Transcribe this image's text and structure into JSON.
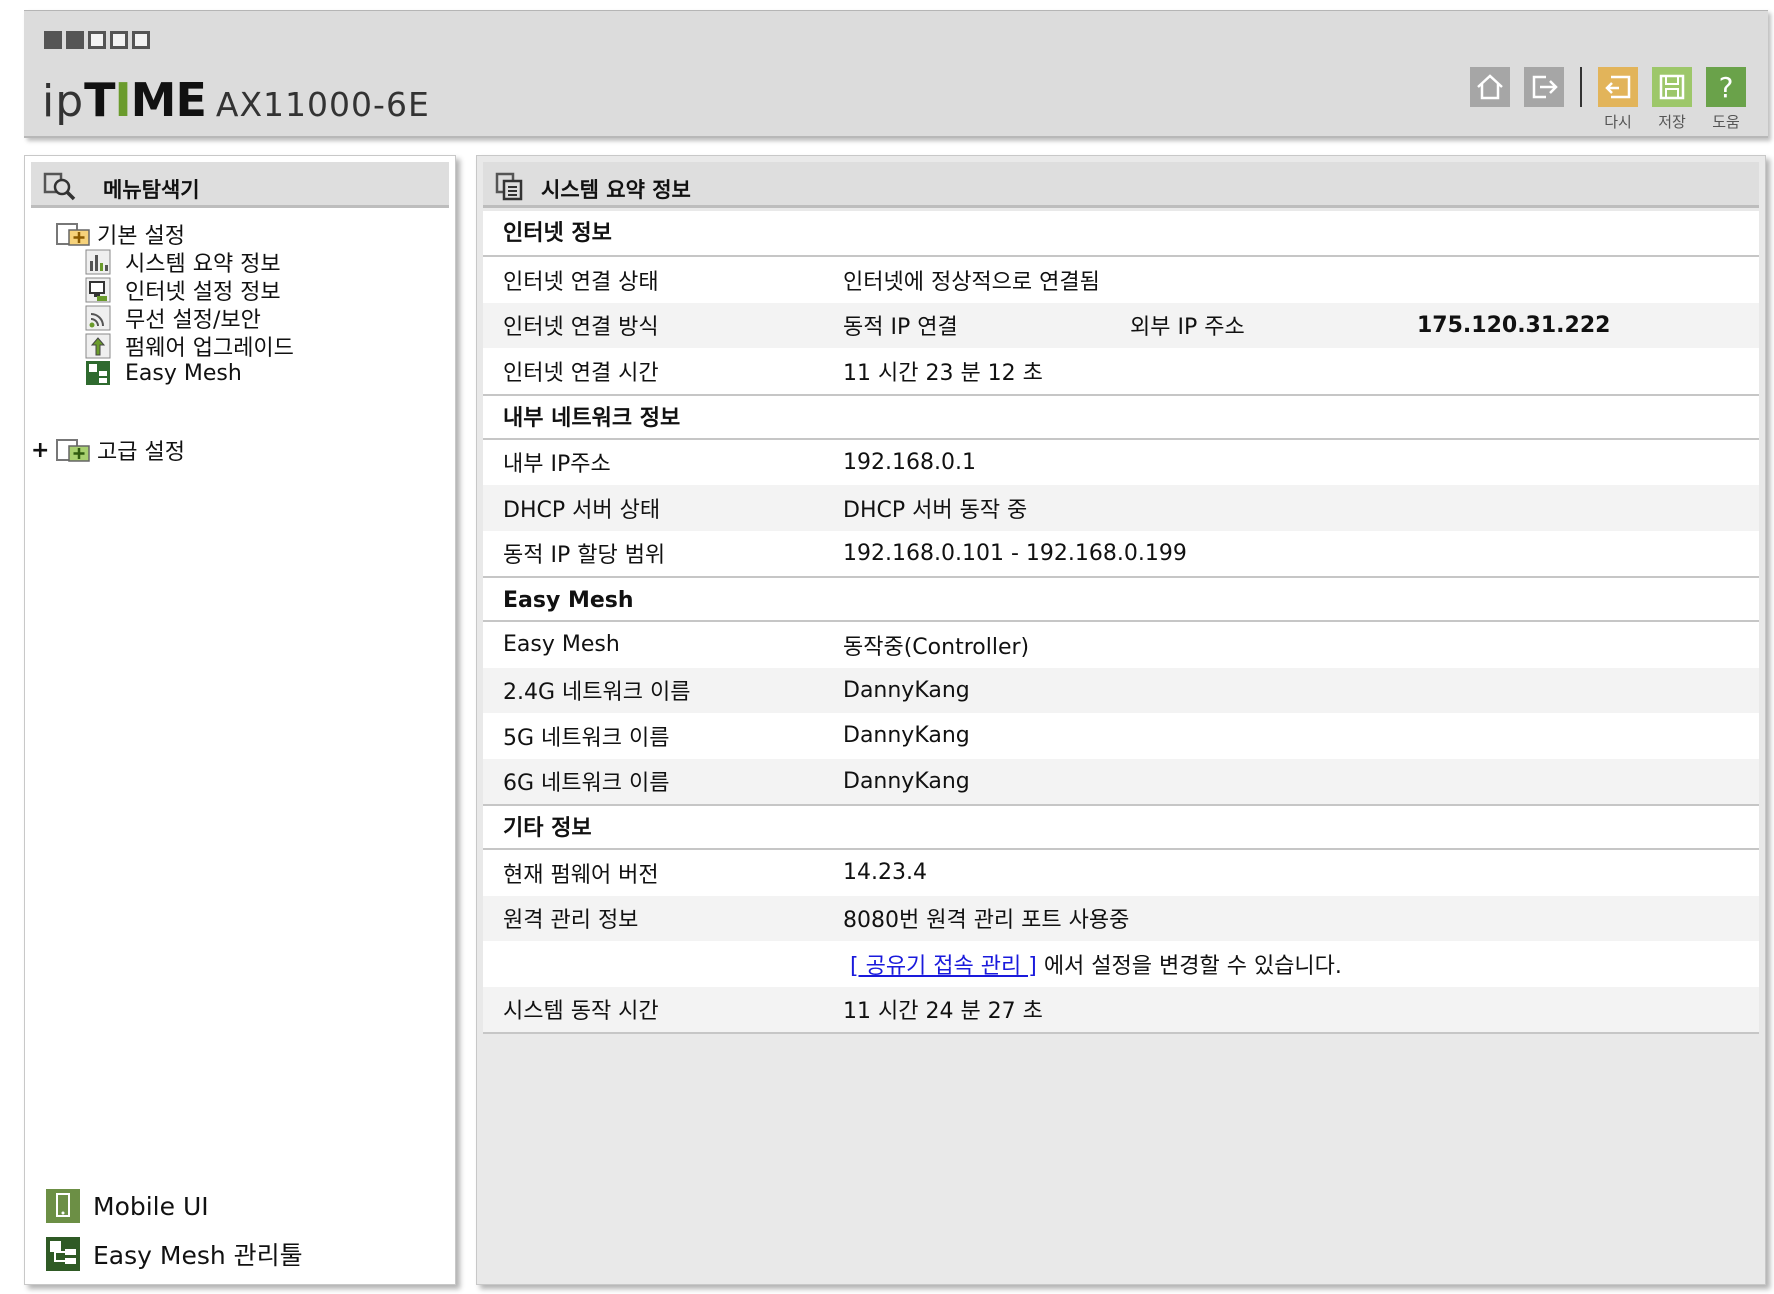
{
  "header": {
    "logo_ip": "ip",
    "logo_time_a": "T",
    "logo_time_b": "I",
    "logo_time_c": "ME",
    "model": "AX11000-6E",
    "toolbar": {
      "retry_label": "다시",
      "save_label": "저장",
      "help_label": "도움",
      "help_glyph": "?"
    }
  },
  "sidebar": {
    "title": "메뉴탐색기",
    "basic": {
      "label": "기본 설정",
      "items": [
        {
          "label": "시스템 요약 정보",
          "icon": "bar-chart-icon"
        },
        {
          "label": "인터넷 설정 정보",
          "icon": "monitor-icon"
        },
        {
          "label": "무선 설정/보안",
          "icon": "wireless-icon"
        },
        {
          "label": "펌웨어 업그레이드",
          "icon": "upgrade-arrow-icon"
        },
        {
          "label": "Easy Mesh",
          "icon": "mesh-icon"
        }
      ]
    },
    "advanced": {
      "expander": "+",
      "label": "고급 설정"
    },
    "bottom": {
      "mobile_ui": "Mobile UI",
      "mesh_tool": "Easy Mesh 관리툴"
    }
  },
  "main": {
    "title": "시스템 요약 정보",
    "internet": {
      "heading": "인터넷 정보",
      "status_label": "인터넷 연결 상태",
      "status_value": "인터넷에 정상적으로 연결됨",
      "method_label": "인터넷 연결 방식",
      "method_value": "동적 IP 연결",
      "ext_ip_label": "외부 IP 주소",
      "ext_ip_value": "175.120.31.222",
      "time_label": "인터넷 연결 시간",
      "time_value": "11 시간 23 분 12 초"
    },
    "lan": {
      "heading": "내부 네트워크 정보",
      "ip_label": "내부 IP주소",
      "ip_value": "192.168.0.1",
      "dhcp_label": "DHCP 서버 상태",
      "dhcp_value": "DHCP 서버 동작 중",
      "range_label": "동적 IP 할당 범위",
      "range_value": "192.168.0.101 -  192.168.0.199"
    },
    "mesh": {
      "heading": "Easy Mesh",
      "mesh_label": "Easy Mesh",
      "mesh_value": "동작중(Controller)",
      "g24_label": "2.4G 네트워크 이름",
      "g24_value": "DannyKang",
      "g5_label": "5G 네트워크 이름",
      "g5_value": "DannyKang",
      "g6_label": "6G 네트워크 이름",
      "g6_value": "DannyKang"
    },
    "etc": {
      "heading": "기타 정보",
      "fw_label": "현재 펌웨어 버전",
      "fw_value": "14.23.4",
      "remote_label": "원격 관리 정보",
      "remote_value": "8080번 원격 관리 포트 사용중",
      "remote_link": "[ 공유기 접속 관리 ]",
      "remote_note": " 에서 설정을 변경할 수 있습니다.",
      "uptime_label": "시스템 동작 시간",
      "uptime_value": "11 시간 24 분 27 초"
    }
  },
  "colors": {
    "header_bg": "#dcdcdc",
    "retry": "#e2b45a",
    "save": "#9dc76a",
    "help": "#6aa24a",
    "link": "#1a1adc"
  }
}
